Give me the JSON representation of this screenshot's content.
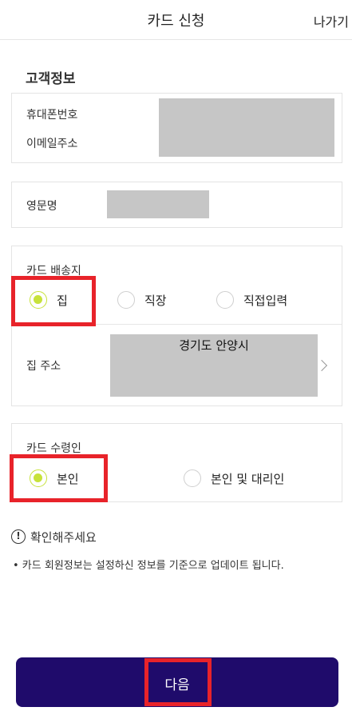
{
  "header": {
    "title": "카드 신청",
    "exit_label": "나가기"
  },
  "customer_info": {
    "section_title": "고객정보",
    "phone_label": "휴대폰번호",
    "email_label": "이메일주소",
    "english_name_label": "영문명"
  },
  "delivery": {
    "title": "카드 배송지",
    "options": [
      {
        "label": "집",
        "selected": true
      },
      {
        "label": "직장",
        "selected": false
      },
      {
        "label": "직접입력",
        "selected": false
      }
    ],
    "address_label": "집 주소",
    "address_value": "경기도 안양시"
  },
  "recipient": {
    "title": "카드 수령인",
    "options": [
      {
        "label": "본인",
        "selected": true
      },
      {
        "label": "본인 및 대리인",
        "selected": false
      }
    ]
  },
  "notice": {
    "title": "확인해주세요",
    "text": "• 카드 회원정보는 설정하신 정보를 기준으로 업데이트 됩니다."
  },
  "footer": {
    "next_label": "다음"
  },
  "colors": {
    "accent_radio": "#c7e23a",
    "button_bg": "#1f0b6b",
    "highlight": "#e8232a"
  }
}
